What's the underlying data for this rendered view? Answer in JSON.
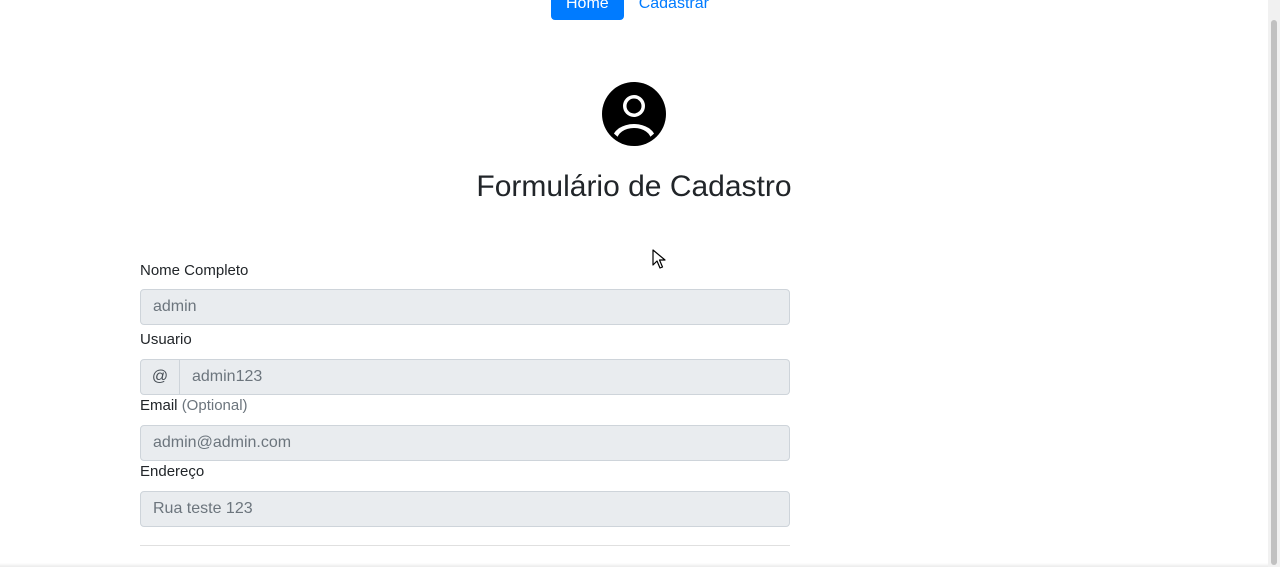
{
  "nav": {
    "items": [
      {
        "label": "Home",
        "active": true
      },
      {
        "label": "Cadastrar",
        "active": false
      }
    ]
  },
  "header": {
    "avatar_icon": "user-circle-icon",
    "title": "Formulário de Cadastro"
  },
  "form": {
    "nome": {
      "label": "Nome Completo",
      "value": "admin"
    },
    "usuario": {
      "label": "Usuario",
      "prefix": "@",
      "value": "admin123"
    },
    "email": {
      "label": "Email",
      "label_hint": "(Optional)",
      "value": "admin@admin.com"
    },
    "endereco": {
      "label": "Endereço",
      "value": "Rua teste 123"
    }
  },
  "colors": {
    "accent": "#007bff",
    "input_bg": "#e9ecef",
    "muted": "#6c757d"
  }
}
